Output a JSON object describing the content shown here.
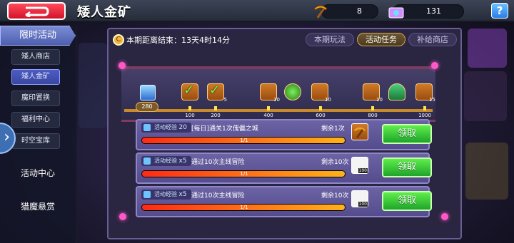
{
  "header": {
    "title": "矮人金矿",
    "pickaxe_count": "8",
    "ticket_count": "131",
    "help_label": "?"
  },
  "sidebar": {
    "section_label": "限时活动",
    "items": [
      {
        "label": "矮人商店",
        "active": false
      },
      {
        "label": "矮人金矿",
        "active": true
      },
      {
        "label": "魔印置换",
        "active": false
      },
      {
        "label": "福利中心",
        "active": false
      },
      {
        "label": "时空宝库",
        "active": false
      }
    ],
    "activity_center_label": "活动中心",
    "hunt_bounty_label": "猎魔悬赏"
  },
  "panel": {
    "timer_text": "本期距离结束：13天4时14分",
    "tabs": [
      {
        "label": "本期玩法",
        "active": false
      },
      {
        "label": "活动任务",
        "active": true
      },
      {
        "label": "补给商店",
        "active": false
      }
    ],
    "progress": {
      "exp_value": "280",
      "milestones": [
        "100",
        "200",
        "400",
        "600",
        "800",
        "1000"
      ],
      "reward_qty": [
        "5",
        "",
        "",
        "10",
        "10",
        "10",
        "15"
      ]
    },
    "tasks": [
      {
        "exp_label": "活动经验",
        "exp_value": "20",
        "name": "[每日]通关1次傀儡之城",
        "remaining": "剩余1次",
        "progress_text": "1/1",
        "progress_fraction": 1.0,
        "claim_label": "领取",
        "item_qty": ""
      },
      {
        "exp_label": "活动经验",
        "exp_value": "x5",
        "name": "通过10次主线冒险",
        "remaining": "剩余10次",
        "progress_text": "1/1",
        "progress_fraction": 1.0,
        "claim_label": "领取",
        "item_qty": "100"
      },
      {
        "exp_label": "活动经验",
        "exp_value": "x5",
        "name": "通过10次主线冒险",
        "remaining": "剩余10次",
        "progress_text": "1/1",
        "progress_fraction": 1.0,
        "claim_label": "领取",
        "item_qty": "100"
      }
    ]
  },
  "colors": {
    "claim_green": "#35c937",
    "progress_orange": "#ff7a16",
    "tab_active_gold": "#d9a950"
  }
}
